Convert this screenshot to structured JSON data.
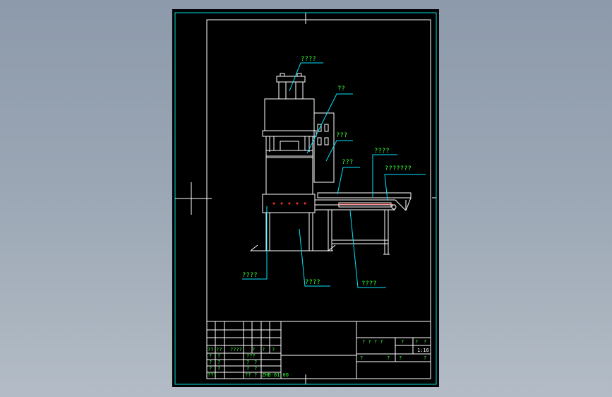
{
  "drawing": {
    "colors": {
      "viewport_bg": "#8d9aab",
      "sheet_bg": "#000000",
      "frame_line": "#ffffff",
      "outer_line": "#00e0e0",
      "leader_line": "#00e5ff",
      "callout_text": "#39ff39",
      "indicator": "#ff3030"
    },
    "callouts": [
      {
        "id": "cylinder",
        "text": "????"
      },
      {
        "id": "top-beam",
        "text": "??"
      },
      {
        "id": "control-box",
        "text": "???"
      },
      {
        "id": "guide",
        "text": "???"
      },
      {
        "id": "conveyor-top",
        "text": "????"
      },
      {
        "id": "conveyor-belt",
        "text": "???????"
      },
      {
        "id": "base-left",
        "text": "????"
      },
      {
        "id": "frame-bottom",
        "text": "????"
      },
      {
        "id": "conveyor-frame",
        "text": "????"
      }
    ],
    "title_block": {
      "left_rows": [
        {
          "cells": [
            "??",
            "??",
            "????",
            "?",
            "?",
            "?"
          ]
        },
        {
          "cells": [
            "?",
            "?",
            "",
            "???",
            "",
            ""
          ]
        },
        {
          "cells": [
            "?",
            "?",
            "",
            "?",
            "?",
            ""
          ]
        },
        {
          "cells": [
            "?",
            "?",
            "",
            "?",
            "?",
            ""
          ]
        },
        {
          "cells": [
            "???",
            "",
            "",
            "??",
            "?",
            ""
          ]
        }
      ],
      "drawing_no": "ZHB-01.00",
      "right": {
        "row1": [
          "? ? ? ?",
          "?",
          "?",
          "?"
        ],
        "scale": "1:16",
        "row3": [
          "?",
          "?",
          "?",
          "?"
        ]
      }
    }
  }
}
